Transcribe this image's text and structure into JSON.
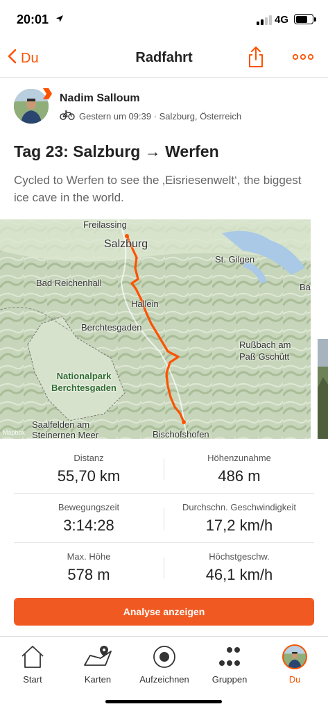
{
  "status": {
    "time": "20:01",
    "network": "4G"
  },
  "nav": {
    "back_label": "Du",
    "title": "Radfahrt",
    "share_icon": "share-icon",
    "more_icon": "more-dots-icon"
  },
  "athlete": {
    "name": "Nadim Salloum",
    "meta": "Gestern um 09:39 · Salzburg, Österreich",
    "activity_icon": "bike-icon"
  },
  "activity": {
    "title": "Tag 23: Salzburg → Werfen",
    "description": "Cycled to Werfen to see the ‚Eisriesenwelt‘, the biggest ice cave in the world."
  },
  "map": {
    "labels": {
      "freilassing": "Freilassing",
      "salzburg": "Salzburg",
      "st_gilgen": "St. Gilgen",
      "bad_reichenhall": "Bad Reichenhall",
      "hallein": "Hallein",
      "berchtesgaden": "Berchtesgaden",
      "russbach": "Rußbach am\nPaß Gschütt",
      "np_berchtesgaden": "Nationalpark\nBerchtesgaden",
      "saalfelden": "Saalfelden am\nSteinernen Meer",
      "bischofshofen": "Bischofshofen",
      "ba": "Ba"
    },
    "attribution": "Mapbox",
    "route_color": "#fc5200"
  },
  "stats": [
    {
      "left_label": "Distanz",
      "left_value": "55,70 km",
      "right_label": "Höhenzunahme",
      "right_value": "486 m"
    },
    {
      "left_label": "Bewegungszeit",
      "left_value": "3:14:28",
      "right_label": "Durchschn. Geschwindigkeit",
      "right_value": "17,2 km/h"
    },
    {
      "left_label": "Max. Höhe",
      "left_value": "578 m",
      "right_label": "Höchstgeschw.",
      "right_value": "46,1 km/h"
    }
  ],
  "analyze_button": "Analyse anzeigen",
  "tabs": [
    {
      "label": "Start",
      "icon": "home-icon"
    },
    {
      "label": "Karten",
      "icon": "map-icon"
    },
    {
      "label": "Aufzeichnen",
      "icon": "record-icon"
    },
    {
      "label": "Gruppen",
      "icon": "groups-icon"
    },
    {
      "label": "Du",
      "icon": "profile-avatar",
      "active": true
    }
  ],
  "colors": {
    "accent": "#fc5200",
    "button": "#f05a22"
  }
}
